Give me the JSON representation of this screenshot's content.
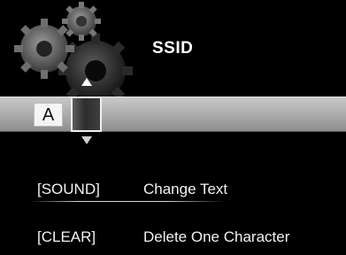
{
  "header": {
    "title": "SSID",
    "emblem_icon": "gears-icon"
  },
  "text_entry": {
    "entered_characters": "A",
    "cursor_char": "",
    "up_arrow_icon": "triangle-up-icon",
    "down_arrow_icon": "triangle-down-icon"
  },
  "help": [
    {
      "key": "[SOUND]",
      "action": "Change Text"
    },
    {
      "key": "[CLEAR]",
      "action": "Delete One Character"
    }
  ],
  "colors": {
    "background": "#000000",
    "bar": "#a9a9a9",
    "text": "#ffffff"
  }
}
